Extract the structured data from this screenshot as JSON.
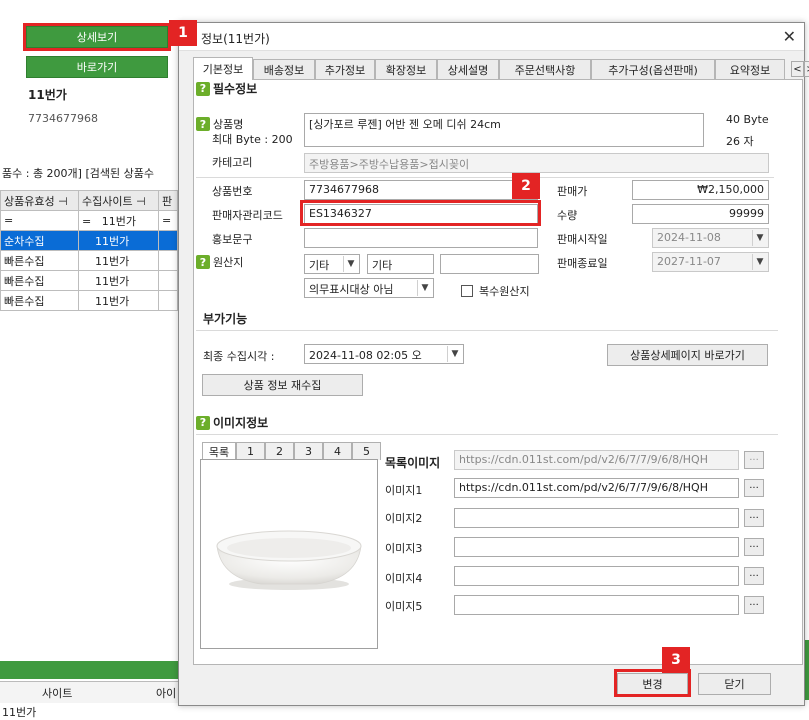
{
  "background": {
    "detail_button": "상세보기",
    "goto_button": "바로가기",
    "site_name": "11번가",
    "product_code": "7734677968",
    "count_text": "품수 : 총 200개] [검색된 상품수",
    "grid": {
      "headers": [
        "상품유효성",
        "수집사이트",
        "판"
      ],
      "filter_row": [
        "=",
        "=",
        "11번가",
        "="
      ],
      "rows": [
        {
          "status": "순차수집",
          "site": "11번가"
        },
        {
          "status": "빠른수집",
          "site": "11번가"
        },
        {
          "status": "빠른수집",
          "site": "11번가"
        },
        {
          "status": "빠른수집",
          "site": "11번가"
        }
      ]
    },
    "bottom_headers": [
      "사이트",
      "아이"
    ],
    "bottom_cell": "11번가"
  },
  "dialog": {
    "title": "정보(11번가)",
    "close": "✕",
    "tabs": [
      "기본정보",
      "배송정보",
      "추가정보",
      "확장정보",
      "상세설명",
      "주문선택사항",
      "추가구성(옵션판매)",
      "요약정보"
    ],
    "tab_prev": "<",
    "tab_next": ">",
    "required_section": "필수정보",
    "product_name_label": "상품명",
    "max_byte_label": "최대 Byte : 200",
    "product_name_value": "[싱가포르 루젠] 어반 젠 오메 디쉬 24cm",
    "byte_count": "40 Byte",
    "char_count": "26 자",
    "category_label": "카테고리",
    "category_value": "주방용품>주방수납용품>접시꽂이",
    "product_no_label": "상품번호",
    "product_no_value": "7734677968",
    "seller_code_label": "판매자관리코드",
    "seller_code_value": "ES1346327",
    "promo_label": "홍보문구",
    "promo_value": "",
    "origin_label": "원산지",
    "origin_select": "기타",
    "origin_text": "기타",
    "origin_extra": "",
    "origin_notice": "의무표시대상 아님",
    "multi_origin_label": "복수원산지",
    "price_label": "판매가",
    "price_value": "₩2,150,000",
    "qty_label": "수량",
    "qty_value": "99999",
    "sale_start_label": "판매시작일",
    "sale_start_value": "2024-11-08",
    "sale_end_label": "판매종료일",
    "sale_end_value": "2027-11-07",
    "extra_section": "부가기능",
    "collect_time_label": "최종 수집시각 :",
    "collect_time_value": "2024-11-08  02:05 오",
    "detail_page_button": "상품상세페이지 바로가기",
    "recollect_button": "상품 정보 재수집",
    "image_section": "이미지정보",
    "image_tabs": [
      "목록",
      "1",
      "2",
      "3",
      "4",
      "5"
    ],
    "list_image_label": "목록이미지",
    "list_image_value": "https://cdn.011st.com/pd/v2/6/7/7/9/6/8/HQH",
    "image1_label": "이미지1",
    "image1_value": "https://cdn.011st.com/pd/v2/6/7/7/9/6/8/HQH",
    "image2_label": "이미지2",
    "image3_label": "이미지3",
    "image4_label": "이미지4",
    "image5_label": "이미지5",
    "browse": "···",
    "change_button": "변경",
    "close_button": "닫기"
  },
  "annotations": [
    "1",
    "2",
    "3"
  ],
  "colors": {
    "accent_green": "#3f9a3f",
    "selection_blue": "#0a6cd6",
    "callout_red": "#e32424"
  }
}
